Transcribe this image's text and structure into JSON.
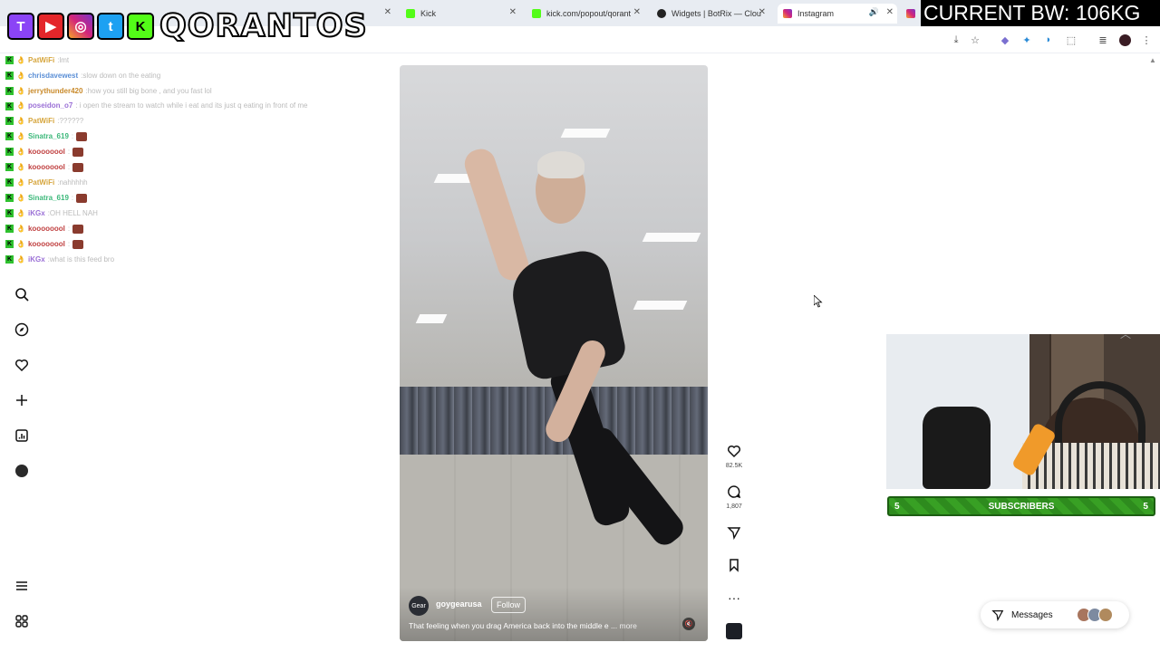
{
  "browser": {
    "tabs": [
      {
        "label": "",
        "favicon": "instagram-icon"
      },
      {
        "label": "Kick",
        "favicon": "kick-icon"
      },
      {
        "label": "kick.com/popout/qorant",
        "favicon": "kick-icon"
      },
      {
        "label": "Widgets | BotRix — Clou",
        "favicon": "botrix-icon"
      },
      {
        "label": "Instagram",
        "favicon": "instagram-icon"
      }
    ],
    "active_tab": "Instagram"
  },
  "overlay": {
    "brand": "QORANTOS",
    "brand_letters": {
      "twitch": "T",
      "youtube": "▶",
      "instagram": "◎",
      "twitter": "t",
      "kick": "K"
    },
    "bw_banner": "CURRENT BW: 106KG"
  },
  "chat": [
    {
      "user": "PatWiFi",
      "color": "#d6a53c",
      "message": "lmt"
    },
    {
      "user": "chrisdavewest",
      "color": "#5b8fd6",
      "message": "slow down on the eating"
    },
    {
      "user": "jerrythunder420",
      "color": "#c98a2a",
      "message": "how you still big bone , and you fast lol"
    },
    {
      "user": "poseidon_o7",
      "color": "#9a6fd6",
      "message": "i open the stream to watch while i eat and its just q eating in front of me"
    },
    {
      "user": "PatWiFi",
      "color": "#d6a53c",
      "message": "??????"
    },
    {
      "user": "Sinatra_619",
      "color": "#3cb87a",
      "message": ""
    },
    {
      "user": "koooooool",
      "color": "#c04040",
      "message": ""
    },
    {
      "user": "koooooool",
      "color": "#c04040",
      "message": ""
    },
    {
      "user": "PatWiFi",
      "color": "#d6a53c",
      "message": "nahhhhh"
    },
    {
      "user": "Sinatra_619",
      "color": "#3cb87a",
      "message": ""
    },
    {
      "user": "iKGx",
      "color": "#9a6fd6",
      "message": "OH HELL NAH"
    },
    {
      "user": "koooooool",
      "color": "#c04040",
      "message": ""
    },
    {
      "user": "koooooool",
      "color": "#c04040",
      "message": ""
    },
    {
      "user": "iKGx",
      "color": "#9a6fd6",
      "message": "what is this feed bro"
    }
  ],
  "post": {
    "username": "goygearusa",
    "avatar_text": "Gear",
    "follow_label": "Follow",
    "caption": "That feeling when you drag America back into the middle e ...",
    "more_label": "more",
    "likes": "82.5K",
    "comments": "1,807"
  },
  "messages": {
    "label": "Messages"
  },
  "subscribers": {
    "left": "5",
    "label": "SUBSCRIBERS",
    "right": "5"
  },
  "colors": {
    "kick_green": "#53fc18",
    "subs_green": "#2e8b1e"
  }
}
